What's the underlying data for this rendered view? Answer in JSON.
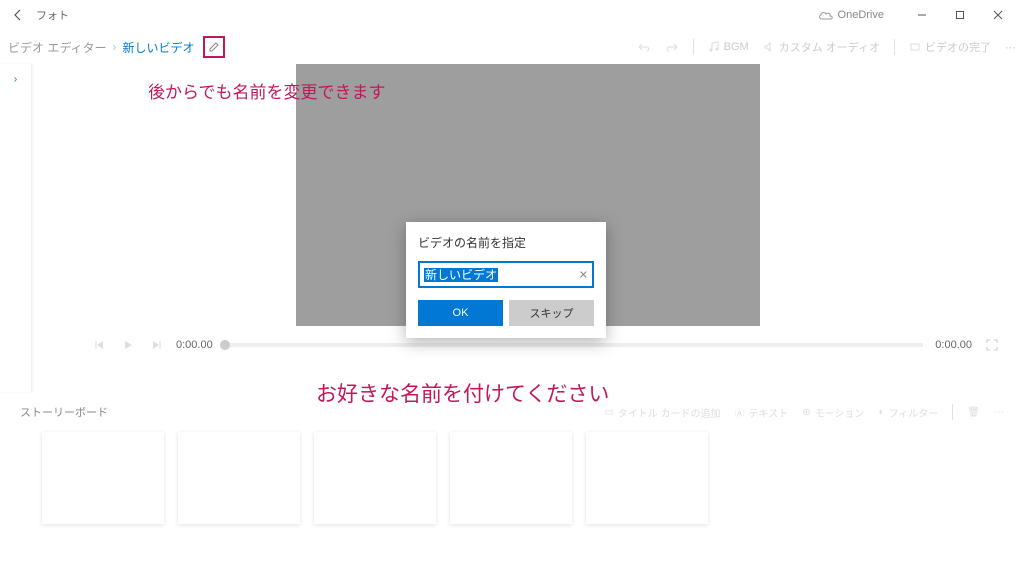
{
  "titlebar": {
    "backIcon": "back",
    "appTitle": "フォト",
    "onedrive": "OneDrive"
  },
  "breadcrumb": {
    "root": "ビデオ エディター",
    "current": "新しいビデオ"
  },
  "toolbarActions": {
    "bgm": "BGM",
    "customAudio": "カスタム オーディオ",
    "finish": "ビデオの完了"
  },
  "annotations": {
    "renameLater": "後からでも名前を変更できます",
    "nameIt": "お好きな名前を付けてください"
  },
  "dialog": {
    "title": "ビデオの名前を指定",
    "value": "新しいビデオ",
    "ok": "OK",
    "skip": "スキップ"
  },
  "playback": {
    "cur": "0:00.00",
    "dur": "0:00.00"
  },
  "storyboard": {
    "title": "ストーリーボード",
    "actions": {
      "addTitle": "タイトル カードの追加",
      "text": "テキスト",
      "motion": "モーション",
      "filter": "フィルター"
    }
  }
}
